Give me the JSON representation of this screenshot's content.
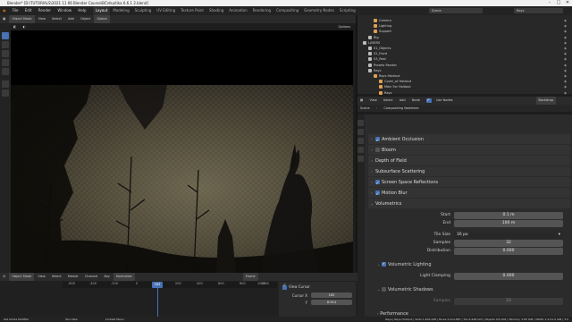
{
  "window": {
    "title": "Blender* [D:\\TUTORIALS\\2021 11 06 Blender Course\\BC\\dsuitika 6.6.1 2.blend]"
  },
  "menu": [
    "File",
    "Edit",
    "Render",
    "Window",
    "Help"
  ],
  "workspaces": [
    "Layout",
    "Modeling",
    "Sculpting",
    "UV Editing",
    "Texture Paint",
    "Shading",
    "Animation",
    "Rendering",
    "Compositing",
    "Geometry Nodes",
    "Scripting"
  ],
  "active_workspace": "Layout",
  "scene_field": "Scene",
  "viewlayer_field": "Rays",
  "viewport": {
    "mode": "Object Mode",
    "menus": [
      "View",
      "Select",
      "Add",
      "Object"
    ],
    "orientation": "Global",
    "options_label": "Options"
  },
  "outliner": {
    "rows": [
      {
        "label": "Camera",
        "color": "#e0a050",
        "indent": 3
      },
      {
        "label": "Lighting",
        "color": "#e0a050",
        "indent": 3
      },
      {
        "label": "Support",
        "color": "#e0a050",
        "indent": 3
      },
      {
        "label": "Rig",
        "color": "#bbbbbb",
        "indent": 2
      },
      {
        "label": "LAYERS",
        "color": "#bbbbbb",
        "indent": 1
      },
      {
        "label": "01_Objects",
        "color": "#bbbbbb",
        "indent": 2
      },
      {
        "label": "02_Front",
        "color": "#bbbbbb",
        "indent": 2
      },
      {
        "label": "03_Rest",
        "color": "#bbbbbb",
        "indent": 2
      },
      {
        "label": "Proxels Render",
        "color": "#bbbbbb",
        "indent": 2
      },
      {
        "label": "Rays",
        "color": "#bbbbbb",
        "indent": 2
      },
      {
        "label": "Rays Holdout",
        "color": "#e0a050",
        "indent": 3
      },
      {
        "label": "Cover_of Holdout",
        "color": "#e0a050",
        "indent": 4
      },
      {
        "label": "Main For Holdout",
        "color": "#e0a050",
        "indent": 4
      },
      {
        "label": "Rays",
        "color": "#e0a050",
        "indent": 4
      }
    ]
  },
  "node_header": {
    "menus": [
      "View",
      "Select",
      "Add",
      "Node"
    ],
    "use_nodes": "Use Nodes",
    "backdrop": "Backdrop",
    "breadcrumb": [
      "Scene",
      "Compositing Nodetree"
    ]
  },
  "properties": {
    "sections": [
      {
        "label": "Ambient Occlusion",
        "checkbox": "on",
        "expanded": false
      },
      {
        "label": "Bloom",
        "checkbox": "off",
        "expanded": false
      },
      {
        "label": "Depth of Field",
        "checkbox": "none",
        "expanded": false
      },
      {
        "label": "Subsurface Scattering",
        "checkbox": "none",
        "expanded": false
      },
      {
        "label": "Screen Space Reflections",
        "checkbox": "on",
        "expanded": false
      },
      {
        "label": "Motion Blur",
        "checkbox": "on",
        "expanded": false
      },
      {
        "label": "Volumetrics",
        "checkbox": "none",
        "expanded": true
      }
    ],
    "volumetrics": {
      "start_label": "Start",
      "start": "0.1 m",
      "end_label": "End",
      "end": "100 m",
      "tile_label": "Tile Size",
      "tile": "16 px",
      "samples_label": "Samples",
      "samples": "32",
      "distribution_label": "Distribution",
      "distribution": "0.000",
      "lighting_label": "Volumetric Lighting",
      "clamp_label": "Light Clamping",
      "clamp": "0.000",
      "shadows_label": "Volumetric Shadows",
      "shadow_samples_label": "Samples",
      "shadow_samples": "16"
    },
    "next_section": "Performance"
  },
  "timeline": {
    "mode": "Object Mode",
    "menus": [
      "View",
      "Select",
      "Marker",
      "Channel",
      "Key"
    ],
    "normalize": "Normalize",
    "frame_label": "Frame",
    "ticks": [
      "-600",
      "-400",
      "-200",
      "0",
      "200",
      "400",
      "600",
      "800",
      "1000",
      "1200"
    ],
    "current_frame": "183",
    "view_cursor": "View Cursor",
    "cursor_x_label": "Cursor X",
    "cursor_x": "183",
    "cursor_y_label": "Y",
    "cursor_y": "8.914"
  },
  "status": {
    "left": "Set Active Modifier",
    "mid1": "Pan View",
    "mid2": "Context Menu",
    "right": "Rays | Rays Holdout | Verts 1,603,248 | Faces 3,214,867 | Tris 6,428,124 | Objects 0/5,204 | Memory: 3.65 GiB | VRAM: 2.2/11.0 GiB | 3.0"
  }
}
